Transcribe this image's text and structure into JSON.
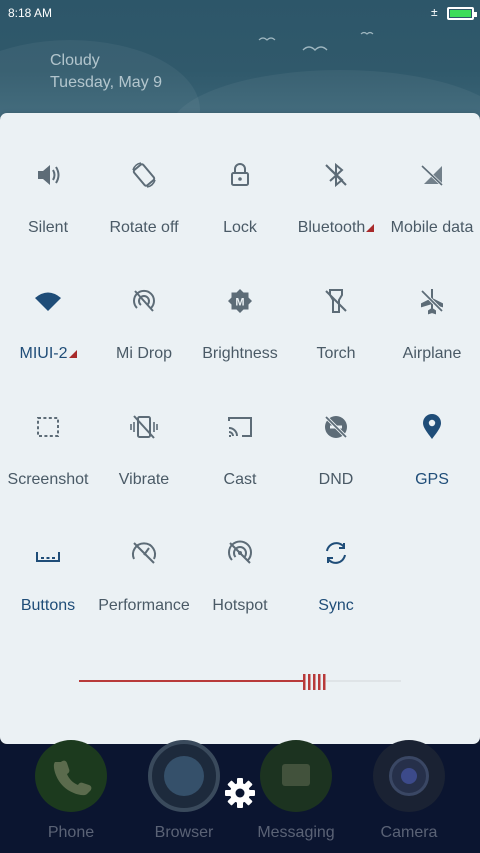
{
  "status_bar": {
    "time": "8:18 AM",
    "charging": "±",
    "battery_color": "#3ddc5a"
  },
  "weather": {
    "condition": "Cloudy",
    "date": "Tuesday, May 9"
  },
  "toggles": [
    {
      "label": "Silent",
      "icon": "speaker-icon",
      "active": false,
      "more": false
    },
    {
      "label": "Rotate off",
      "icon": "rotate-icon",
      "active": false,
      "more": false
    },
    {
      "label": "Lock",
      "icon": "lock-icon",
      "active": false,
      "more": false
    },
    {
      "label": "Bluetooth",
      "icon": "bluetooth-icon",
      "active": false,
      "more": true
    },
    {
      "label": "Mobile data",
      "icon": "mobile-data-off-icon",
      "active": false,
      "more": false
    },
    {
      "label": "MIUI-2",
      "icon": "wifi-icon",
      "active": true,
      "more": true
    },
    {
      "label": "Mi Drop",
      "icon": "mi-drop-icon",
      "active": false,
      "more": false
    },
    {
      "label": "Brightness",
      "icon": "brightness-auto-icon",
      "active": false,
      "more": false
    },
    {
      "label": "Torch",
      "icon": "torch-icon",
      "active": false,
      "more": false
    },
    {
      "label": "Airplane",
      "icon": "airplane-icon",
      "active": false,
      "more": false
    },
    {
      "label": "Screenshot",
      "icon": "screenshot-icon",
      "active": false,
      "more": false
    },
    {
      "label": "Vibrate",
      "icon": "vibrate-icon",
      "active": false,
      "more": false
    },
    {
      "label": "Cast",
      "icon": "cast-icon",
      "active": false,
      "more": false
    },
    {
      "label": "DND",
      "icon": "dnd-icon",
      "active": false,
      "more": false
    },
    {
      "label": "GPS",
      "icon": "location-pin-icon",
      "active": true,
      "more": false
    },
    {
      "label": "Buttons",
      "icon": "buttons-icon",
      "active": true,
      "more": false
    },
    {
      "label": "Performance",
      "icon": "performance-icon",
      "active": false,
      "more": false
    },
    {
      "label": "Hotspot",
      "icon": "hotspot-icon",
      "active": false,
      "more": false
    },
    {
      "label": "Sync",
      "icon": "sync-icon",
      "active": true,
      "more": false
    }
  ],
  "brightness": {
    "level": 0.73,
    "color": "#b83a3a"
  },
  "dock": [
    {
      "label": "Phone",
      "icon": "phone-icon"
    },
    {
      "label": "Browser",
      "icon": "browser-icon"
    },
    {
      "label": "Messaging",
      "icon": "message-icon"
    },
    {
      "label": "Camera",
      "icon": "camera-icon"
    }
  ],
  "colors": {
    "active": "#1f4d78",
    "inactive": "#5d6c77",
    "panel": "#ebf1f4",
    "header": "#30596b"
  }
}
